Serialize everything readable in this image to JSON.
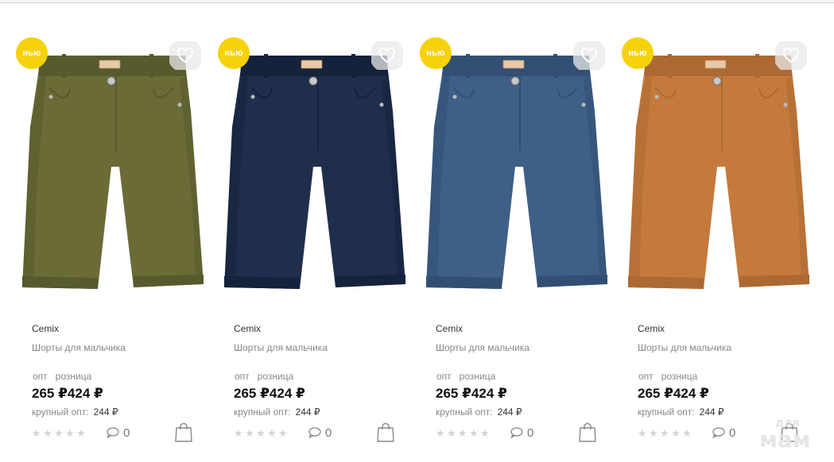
{
  "colors": {
    "badge": "#f5d20a",
    "text": "#222222",
    "muted": "#888888",
    "star": "#d4d4d4"
  },
  "products": [
    {
      "badge": "нью",
      "brand": "Cemix",
      "title": "Шорты для мальчика",
      "label_wholesale": "опт",
      "label_retail": "розница",
      "price_wholesale": "265 ₽",
      "price_retail": "424 ₽",
      "bulk_label": "крупный опт:",
      "bulk_price": "244 ₽",
      "rating": 0,
      "comments": "0",
      "icons": [
        "heart-icon",
        "comment-icon",
        "shopping-bag-icon"
      ],
      "fabric_color": "#6b6b38",
      "fabric_shade": "#575a2c"
    },
    {
      "badge": "нью",
      "brand": "Cemix",
      "title": "Шорты для мальчика",
      "label_wholesale": "опт",
      "label_retail": "розница",
      "price_wholesale": "265 ₽",
      "price_retail": "424 ₽",
      "bulk_label": "крупный опт:",
      "bulk_price": "244 ₽",
      "rating": 0,
      "comments": "0",
      "icons": [
        "heart-icon",
        "comment-icon",
        "shopping-bag-icon"
      ],
      "fabric_color": "#1e2e4c",
      "fabric_shade": "#15223c"
    },
    {
      "badge": "нью",
      "brand": "Cemix",
      "title": "Шорты для мальчика",
      "label_wholesale": "опт",
      "label_retail": "розница",
      "price_wholesale": "265 ₽",
      "price_retail": "424 ₽",
      "bulk_label": "крупный опт:",
      "bulk_price": "244 ₽",
      "rating": 0,
      "comments": "0",
      "icons": [
        "heart-icon",
        "comment-icon",
        "shopping-bag-icon"
      ],
      "fabric_color": "#3e5f86",
      "fabric_shade": "#324f73"
    },
    {
      "badge": "нью",
      "brand": "Cemix",
      "title": "Шорты для мальчика",
      "label_wholesale": "опт",
      "label_retail": "розница",
      "price_wholesale": "265 ₽",
      "price_retail": "424 ₽",
      "bulk_label": "крупный опт:",
      "bulk_price": "244 ₽",
      "rating": 0,
      "comments": "0",
      "icons": [
        "heart-icon",
        "comment-icon",
        "shopping-bag-icon"
      ],
      "fabric_color": "#c47a3c",
      "fabric_shade": "#ad6931"
    }
  ],
  "watermark": {
    "line1": "для",
    "line2": "мам"
  }
}
